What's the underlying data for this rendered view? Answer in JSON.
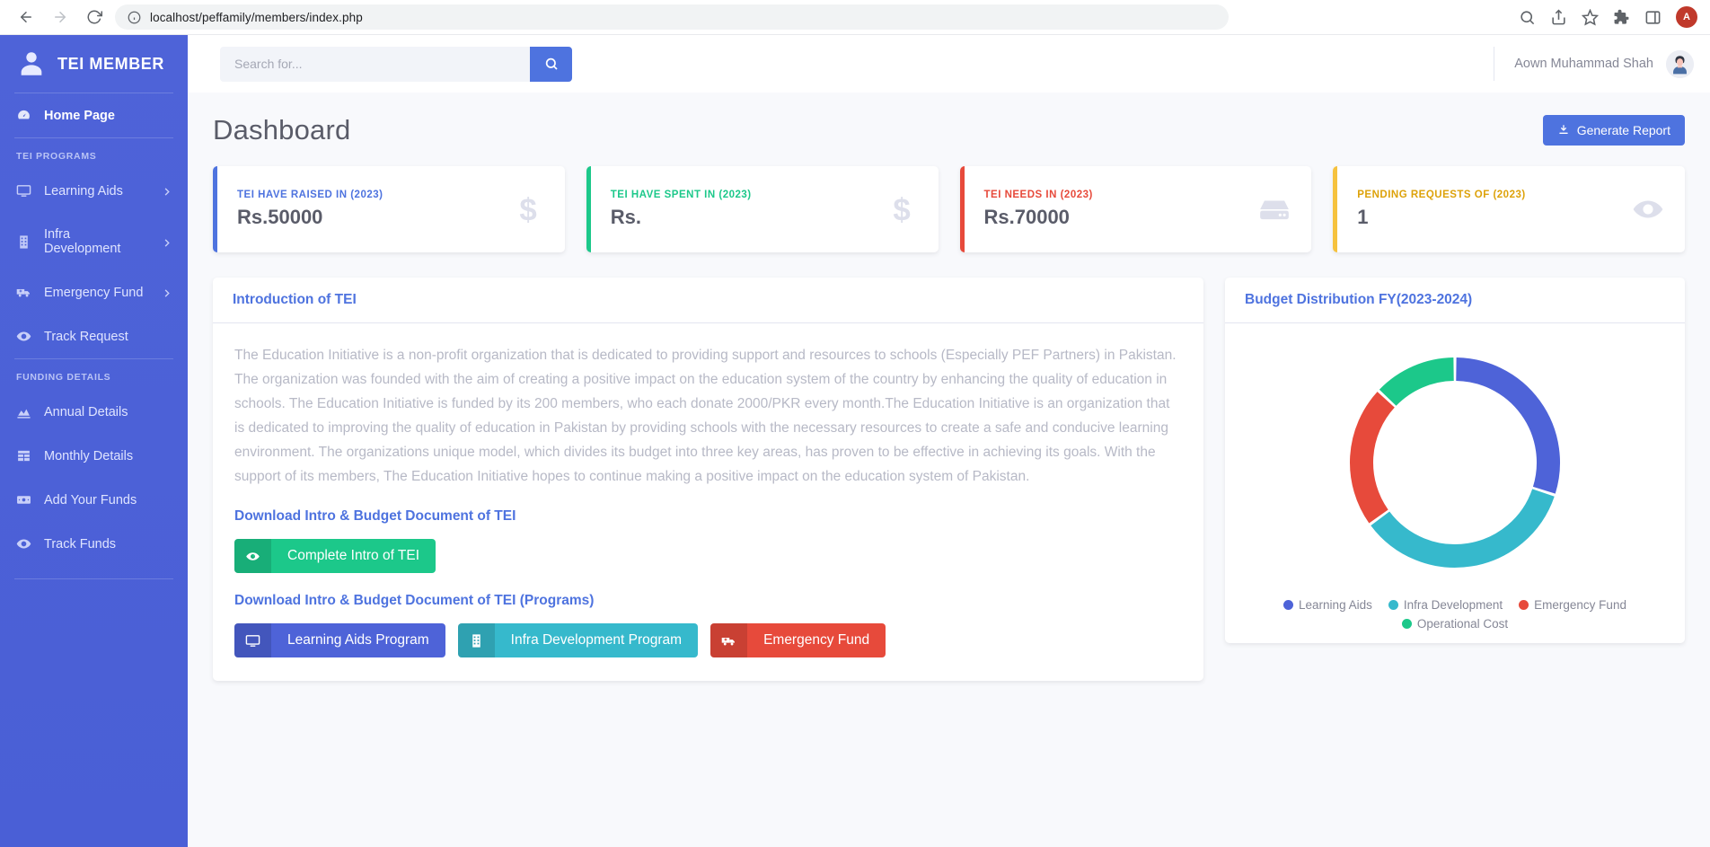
{
  "browser": {
    "url": "localhost/peffamily/members/index.php",
    "back_icon": "back-arrow-icon",
    "forward_icon": "forward-arrow-icon",
    "reload_icon": "reload-icon",
    "info_icon": "site-info-icon",
    "profile_initial": "A"
  },
  "sidebar": {
    "brand": "TEI MEMBER",
    "home": {
      "label": "Home Page",
      "icon": "dashboard-icon"
    },
    "section_programs": "TEI PROGRAMS",
    "section_funding": "FUNDING DETAILS",
    "programs": [
      {
        "label": "Learning Aids",
        "icon": "monitor-icon",
        "caret": true
      },
      {
        "label": "Infra Development",
        "icon": "building-icon",
        "caret": true
      },
      {
        "label": "Emergency Fund",
        "icon": "ambulance-icon",
        "caret": true
      },
      {
        "label": "Track Request",
        "icon": "eye-icon",
        "caret": false
      }
    ],
    "funding": [
      {
        "label": "Annual Details",
        "icon": "chart-area-icon",
        "caret": false
      },
      {
        "label": "Monthly Details",
        "icon": "table-icon",
        "caret": false
      },
      {
        "label": "Add Your Funds",
        "icon": "money-bill-icon",
        "caret": false
      },
      {
        "label": "Track Funds",
        "icon": "eye-icon",
        "caret": false
      }
    ]
  },
  "topbar": {
    "search_placeholder": "Search for...",
    "search_value": "",
    "search_icon": "search-icon",
    "user_name": "Aown Muhammad Shah",
    "avatar": "user-avatar"
  },
  "page": {
    "title": "Dashboard",
    "generate_report": "Generate Report",
    "generate_report_icon": "download-icon"
  },
  "stat_cards": [
    {
      "label": "TEI HAVE RAISED IN (2023)",
      "value": "Rs.50000",
      "accent": "#4e73df",
      "label_color": "#4e73df",
      "icon": "dollar-sign-icon"
    },
    {
      "label": "TEI HAVE SPENT IN (2023)",
      "value": "Rs.",
      "accent": "#1cc88a",
      "label_color": "#1cc88a",
      "icon": "dollar-sign-icon"
    },
    {
      "label": "TEI NEEDS IN (2023)",
      "value": "Rs.70000",
      "accent": "#e74a3b",
      "label_color": "#e74a3b",
      "icon": "hdd-icon"
    },
    {
      "label": "PENDING REQUESTS OF (2023)",
      "value": "1",
      "accent": "#f6c23e",
      "label_color": "#f6c23e",
      "icon": "eye-icon"
    }
  ],
  "intro_panel": {
    "title": "Introduction of TEI",
    "body": "The Education Initiative is a non-profit organization that is dedicated to providing support and resources to schools (Especially PEF Partners) in Pakistan. The organization was founded with the aim of creating a positive impact on the education system of the country by enhancing the quality of education in schools. The Education Initiative is funded by its 200 members, who each donate 2000/PKR every month.The Education Initiative is an organization that is dedicated to improving the quality of education in Pakistan by providing schools with the necessary resources to create a safe and conducive learning environment. The organizations unique model, which divides its budget into three key areas, has proven to be effective in achieving its goals. With the support of its members, The Education Initiative hopes to continue making a positive impact on the education system of Pakistan.",
    "download_heading_1": "Download Intro & Budget Document of TEI",
    "complete_intro_button": {
      "label": "Complete Intro of TEI",
      "icon": "eye-icon",
      "color": "#1cc88a"
    },
    "download_heading_2": "Download Intro & Budget Document of TEI (Programs)",
    "program_buttons": [
      {
        "label": "Learning Aids Program",
        "icon": "monitor-icon",
        "color": "#4e63d8"
      },
      {
        "label": "Infra Development Program",
        "icon": "building-icon",
        "color": "#36b9cc"
      },
      {
        "label": "Emergency Fund",
        "icon": "ambulance-icon",
        "color": "#e74a3b"
      }
    ]
  },
  "chart_data": {
    "type": "pie",
    "title": "Budget Distribution FY(2023-2024)",
    "categories": [
      "Learning Aids",
      "Infra Development",
      "Emergency Fund",
      "Operational Cost"
    ],
    "values": [
      30,
      35,
      22,
      13
    ],
    "colors": [
      "#4e63d8",
      "#36b9cc",
      "#e74a3b",
      "#1cc88a"
    ],
    "legend_position": "bottom",
    "donut": true,
    "xlabel": "",
    "ylabel": ""
  }
}
